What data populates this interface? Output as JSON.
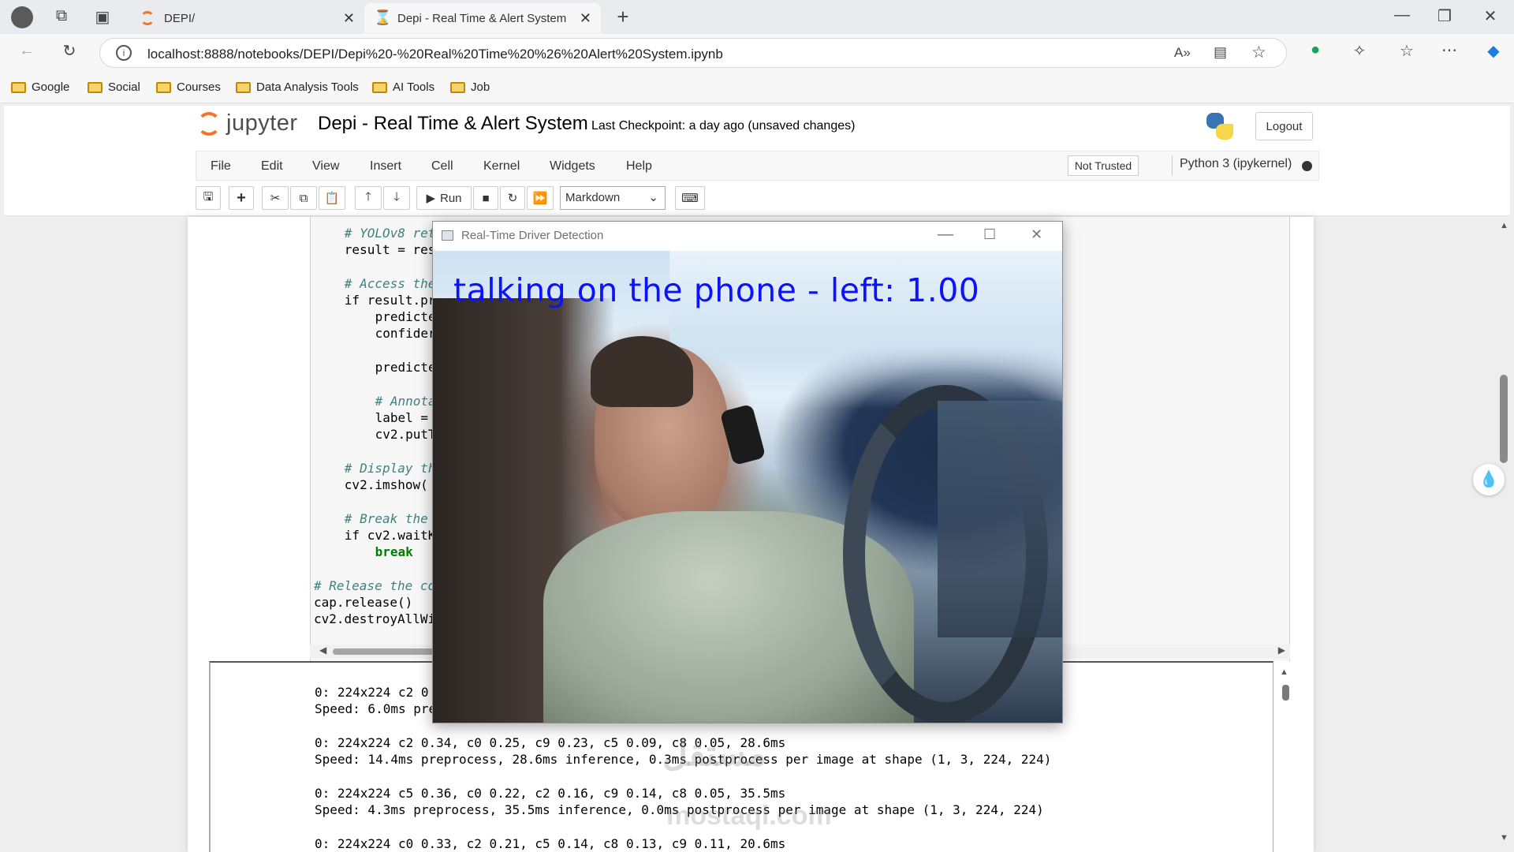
{
  "browser": {
    "tabs": [
      {
        "title": "DEPI/",
        "active": false
      },
      {
        "title": "Depi - Real Time & Alert System ·",
        "active": true
      }
    ],
    "url": "localhost:8888/notebooks/DEPI/Depi%20-%20Real%20Time%20%26%20Alert%20System.ipynb",
    "bookmarks": [
      "Google",
      "Social",
      "Courses",
      "Data Analysis Tools",
      "AI Tools",
      "Job"
    ]
  },
  "jupyter": {
    "logo_text": "jupyter",
    "notebook_title": "Depi - Real Time & Alert System",
    "checkpoint": "Last Checkpoint: a day ago  (unsaved changes)",
    "logout_label": "Logout",
    "menus": [
      "File",
      "Edit",
      "View",
      "Insert",
      "Cell",
      "Kernel",
      "Widgets",
      "Help"
    ],
    "trust_label": "Not Trusted",
    "kernel": "Python 3 (ipykernel)",
    "run_label": "Run",
    "cell_type": "Markdown"
  },
  "code_lines": [
    {
      "indent": "    ",
      "text": "# YOLOv8 ret",
      "kind": "comment"
    },
    {
      "indent": "    ",
      "text": "result = res",
      "kind": "code"
    },
    {
      "indent": "    ",
      "text": "# Access the",
      "kind": "comment"
    },
    {
      "indent": "    ",
      "text": "if result.pr",
      "kind": "code"
    },
    {
      "indent": "        ",
      "text": "predicte",
      "kind": "code"
    },
    {
      "indent": "        ",
      "text": "confider",
      "kind": "code"
    },
    {
      "indent": "        ",
      "text": "predicte",
      "kind": "code"
    },
    {
      "indent": "        ",
      "text": "# Annota",
      "kind": "comment"
    },
    {
      "indent": "        ",
      "text": "label =",
      "kind": "code"
    },
    {
      "indent": "        ",
      "text": "cv2.putT",
      "kind": "code"
    },
    {
      "indent": "    ",
      "text": "# Display th",
      "kind": "comment"
    },
    {
      "indent": "    ",
      "text": "cv2.imshow(",
      "kind": "code"
    },
    {
      "indent": "    ",
      "text": "# Break the",
      "kind": "comment"
    },
    {
      "indent": "    ",
      "text": "if cv2.waitK",
      "kind": "code"
    },
    {
      "indent": "        ",
      "text": "break",
      "kind": "keyword"
    },
    {
      "indent": "",
      "text": "# Release the co",
      "kind": "comment"
    },
    {
      "indent": "",
      "text": "cap.release()",
      "kind": "code"
    },
    {
      "indent": "",
      "text": "cv2.destroyAllWi",
      "kind": "code"
    }
  ],
  "output_lines": [
    "0: 224x224 c2 0",
    "Speed: 6.0ms pre",
    "0: 224x224 c2 0.34, c0 0.25, c9 0.23, c5 0.09, c8 0.05, 28.6ms",
    "Speed: 14.4ms preprocess, 28.6ms inference, 0.3ms postprocess per image at shape (1, 3, 224, 224)",
    "0: 224x224 c5 0.36, c0 0.22, c2 0.16, c9 0.14, c8 0.05, 35.5ms",
    "Speed: 4.3ms preprocess, 35.5ms inference, 0.0ms postprocess per image at shape (1, 3, 224, 224)",
    "0: 224x224 c0 0.33, c2 0.21, c5 0.14, c8 0.13, c9 0.11, 20.6ms"
  ],
  "popup": {
    "title": "Real-Time Driver Detection",
    "caption": "talking on the phone - left: 1.00"
  },
  "watermark": {
    "arabic": "مستقل",
    "latin": "mostaql.com"
  }
}
